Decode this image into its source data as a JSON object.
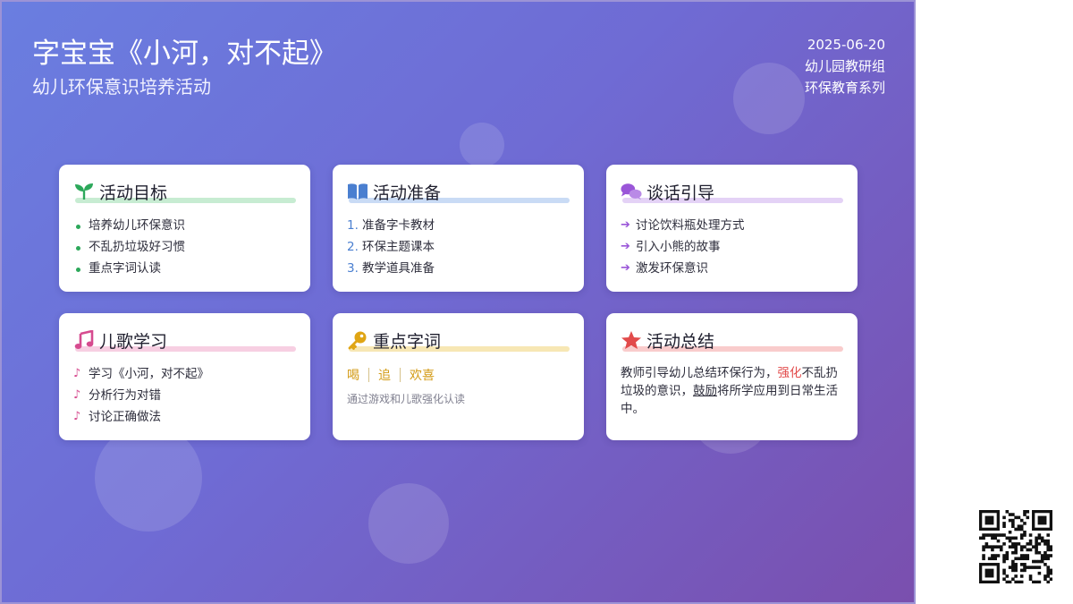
{
  "header": {
    "title": "字宝宝《小河，对不起》",
    "subtitle": "幼儿环保意识培养活动",
    "date": "2025-06-20",
    "org": "幼儿园教研组",
    "series": "环保教育系列"
  },
  "cards": {
    "goals": {
      "title": "活动目标",
      "icon": "seedling-icon",
      "accent": "#2ca85a",
      "items": [
        "培养幼儿环保意识",
        "不乱扔垃圾好习惯",
        "重点字词认读"
      ]
    },
    "prep": {
      "title": "活动准备",
      "icon": "book-icon",
      "accent": "#4a7fd0",
      "items": [
        "准备字卡教材",
        "环保主题课本",
        "教学道具准备"
      ],
      "numbers": [
        "1.",
        "2.",
        "3."
      ]
    },
    "talk": {
      "title": "谈话引导",
      "icon": "chat-bubbles-icon",
      "accent": "#9a56d8",
      "items": [
        "讨论饮料瓶处理方式",
        "引入小熊的故事",
        "激发环保意识"
      ]
    },
    "song": {
      "title": "儿歌学习",
      "icon": "music-note-icon",
      "accent": "#d64b8f",
      "items": [
        "学习《小河，对不起》",
        "分析行为对错",
        "讨论正确做法"
      ]
    },
    "words": {
      "title": "重点字词",
      "icon": "key-icon",
      "accent": "#d39b16",
      "words": [
        "喝",
        "追",
        "欢喜"
      ],
      "hint": "通过游戏和儿歌强化认读"
    },
    "summary": {
      "title": "活动总结",
      "icon": "star-icon",
      "accent": "#e24b4b",
      "text_1": "教师引导幼儿总结环保行为，",
      "highlight": "强化",
      "text_2": "不乱扔垃圾的意识，",
      "underline": "鼓励",
      "text_3": "将所学应用到日常生活中。"
    }
  }
}
